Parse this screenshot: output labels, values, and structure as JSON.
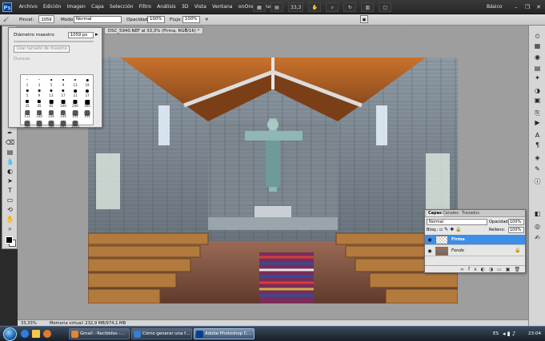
{
  "menubar": {
    "logo": "Ps",
    "items": [
      "Archivo",
      "Edición",
      "Imagen",
      "Capa",
      "Selección",
      "Filtro",
      "Análisis",
      "3D",
      "Vista",
      "Ventana",
      "onOne",
      "Ayuda"
    ],
    "zoom": "33,3",
    "workspace": "Básico"
  },
  "options": {
    "pincel_label": "Pincel:",
    "brush_size": "1059",
    "modo_label": "Modo:",
    "modo_value": "Normal",
    "opacidad_label": "Opacidad:",
    "opacidad_value": "100%",
    "flujo_label": "Flujo:",
    "flujo_value": "100%"
  },
  "document": {
    "tab_title": "DSC_5940.NEF al 33,3% (Firma, RGB/16) *"
  },
  "brush_panel": {
    "diameter_label": "Diámetro maestro",
    "diameter_value": "1059 px",
    "use_sample_button": "Usar tamaño de muestra",
    "hardness_label": "Dureza:",
    "presets": [
      {
        "size": "1"
      },
      {
        "size": "3"
      },
      {
        "size": "5"
      },
      {
        "size": "9"
      },
      {
        "size": "13"
      },
      {
        "size": "19"
      },
      {
        "size": "5"
      },
      {
        "size": "9"
      },
      {
        "size": "13"
      },
      {
        "size": "17"
      },
      {
        "size": "21"
      },
      {
        "size": "27"
      },
      {
        "size": "35"
      },
      {
        "size": "45"
      },
      {
        "size": "65"
      },
      {
        "size": "100"
      },
      {
        "size": "200"
      },
      {
        "size": "300"
      },
      {
        "size": "111"
      },
      {
        "size": "100"
      },
      {
        "size": "104"
      },
      {
        "size": "104"
      },
      {
        "size": "111"
      },
      {
        "size": "111"
      },
      {
        "size": "100"
      },
      {
        "size": "104"
      },
      {
        "size": "104"
      },
      {
        "size": "643"
      },
      {
        "size": "1033"
      }
    ]
  },
  "status": {
    "zoom": "33,33%",
    "memory": "Memoria virtual: 232,9 MB/974,1 MB"
  },
  "layers": {
    "tabs": [
      "Capas",
      "Canales",
      "Trazados"
    ],
    "blend_mode": "Normal",
    "opacity_label": "Opacidad:",
    "opacity_value": "100%",
    "lock_label": "Bloq.:",
    "fill_label": "Relleno:",
    "fill_value": "100%",
    "rows": [
      {
        "name": "Firma",
        "selected": true
      },
      {
        "name": "Fondo",
        "selected": false
      }
    ]
  },
  "taskbar": {
    "tasks": [
      {
        "label": "Gmail - Recibidos -…",
        "color": "#e8842c"
      },
      {
        "label": "Cómo generar una f…",
        "color": "#3a7bd5"
      },
      {
        "label": "Adobe Photoshop C…",
        "color": "#0a3f8c"
      }
    ],
    "language": "ES",
    "time": "23:04"
  }
}
